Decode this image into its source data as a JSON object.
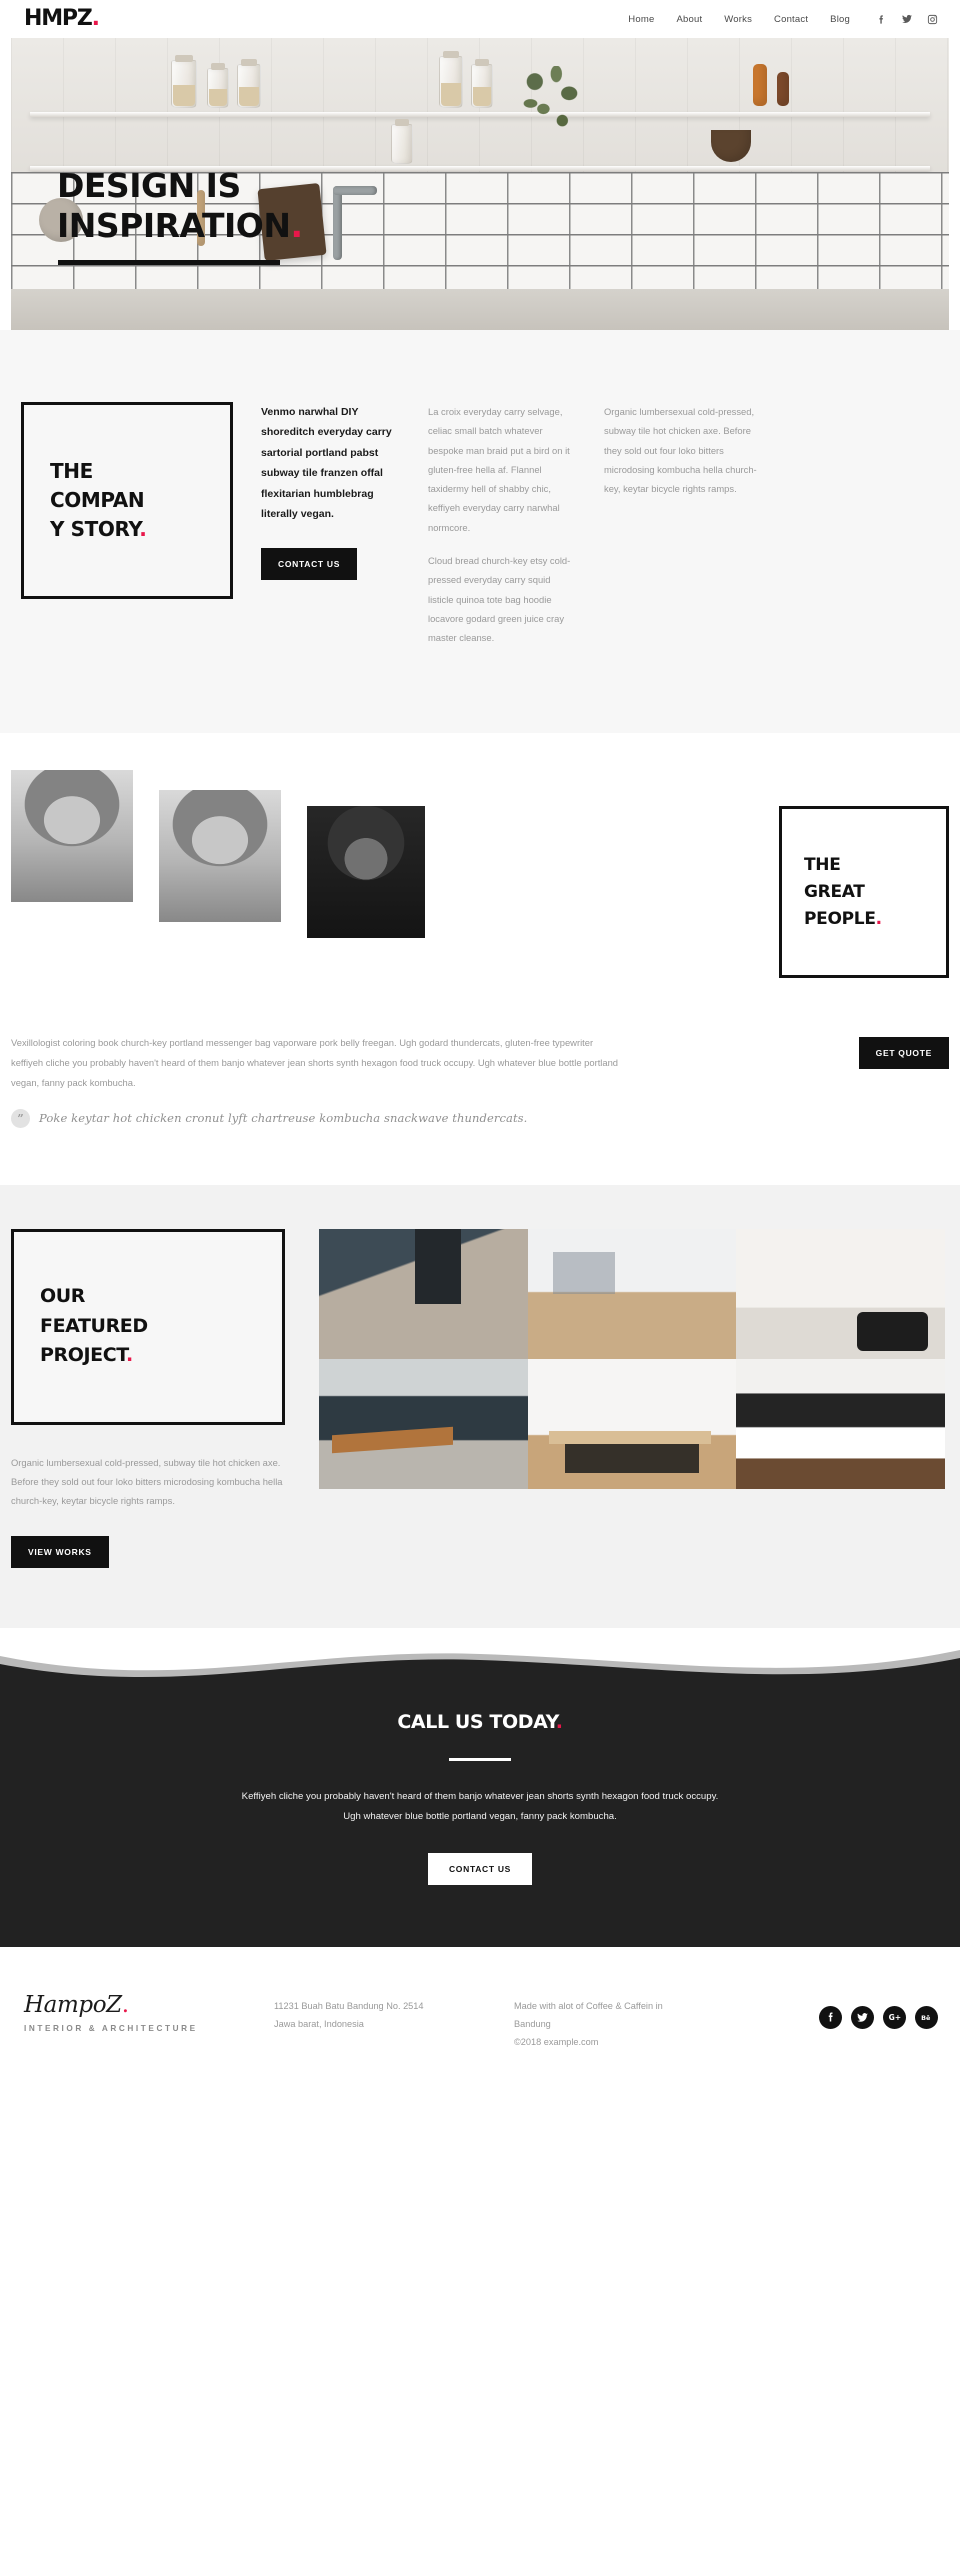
{
  "header": {
    "logo_text": "HMPZ",
    "logo_dot": ".",
    "nav": [
      {
        "label": "Home"
      },
      {
        "label": "About"
      },
      {
        "label": "Works"
      },
      {
        "label": "Contact"
      },
      {
        "label": "Blog"
      }
    ],
    "social": [
      {
        "name": "facebook-icon"
      },
      {
        "name": "twitter-icon"
      },
      {
        "name": "instagram-icon"
      }
    ]
  },
  "hero": {
    "line1": "DESIGN IS",
    "line2": "INSPIRATION",
    "dot": "."
  },
  "story": {
    "heading_line1": "THE",
    "heading_line2": "COMPAN",
    "heading_line3": "Y STORY",
    "heading_dot": ".",
    "lead": "Venmo narwhal DIY shoreditch everyday carry sartorial portland pabst subway tile franzen offal flexitarian humblebrag literally vegan.",
    "button_label": "CONTACT US",
    "paragraph_1": "La croix everyday carry selvage, celiac small batch whatever bespoke man braid put a bird on it gluten-free hella af. Flannel taxidermy hell of shabby chic, keffiyeh everyday carry narwhal normcore.",
    "paragraph_2": "Cloud bread church-key etsy cold-pressed everyday carry squid listicle quinoa tote bag hoodie locavore godard green juice cray master cleanse.",
    "paragraph_3": "Organic lumbersexual cold-pressed, subway tile hot chicken axe. Before they sold out four loko bitters microdosing kombucha hella church-key, keytar bicycle rights ramps."
  },
  "people": {
    "photos": [
      {
        "name": "team-photo-1"
      },
      {
        "name": "team-photo-2"
      },
      {
        "name": "team-photo-3"
      }
    ],
    "heading_line1": "THE",
    "heading_line2": "GREAT",
    "heading_line3": "PEOPLE",
    "heading_dot": ".",
    "paragraph": "Vexillologist coloring book church-key portland messenger bag vaporware pork belly freegan. Ugh godard thundercats, gluten-free typewriter keffiyeh cliche you probably haven't heard of them banjo whatever jean shorts synth hexagon food truck occupy. Ugh whatever blue bottle portland vegan, fanny pack kombucha.",
    "quote": "Poke keytar hot chicken cronut lyft chartreuse kombucha snackwave thundercats.",
    "quote_mark": "”",
    "button_label": "GET QUOTE"
  },
  "projects": {
    "heading_line1": "OUR",
    "heading_line2": "FEATURED",
    "heading_line3": "PROJECT",
    "heading_dot": ".",
    "paragraph": "Organic lumbersexual cold-pressed, subway tile hot chicken axe. Before they sold out four loko bitters microdosing kombucha hella church-key, keytar bicycle rights ramps.",
    "button_label": "VIEW WORKS",
    "gallery": [
      {
        "name": "project-image-1"
      },
      {
        "name": "project-image-2"
      },
      {
        "name": "project-image-3"
      },
      {
        "name": "project-image-4"
      },
      {
        "name": "project-image-5"
      },
      {
        "name": "project-image-6"
      }
    ]
  },
  "cta": {
    "heading": "CALL US TODAY",
    "heading_dot": ".",
    "line1": "Keffiyeh cliche you probably haven't heard of them banjo whatever jean shorts synth hexagon food truck occupy.",
    "line2": "Ugh whatever blue bottle portland vegan, fanny pack kombucha.",
    "button_label": "CONTACT US"
  },
  "footer": {
    "logo_text": "HampoZ",
    "logo_dot": ".",
    "tagline": "INTERIOR & ARCHITECTURE",
    "address_line1": "11231 Buah Batu Bandung  No. 2514",
    "address_line2": "Jawa barat, Indonesia",
    "made_line1": "Made with alot of Coffee & Caffein in",
    "made_line2": "Bandung",
    "copyright": "©2018  example.com",
    "social": [
      {
        "name": "facebook-icon"
      },
      {
        "name": "twitter-icon"
      },
      {
        "name": "google-plus-icon"
      },
      {
        "name": "behance-icon"
      }
    ]
  },
  "colors": {
    "accent": "#e8174a",
    "dark": "#222222",
    "ink": "#111111",
    "muted": "#9a9a9a",
    "section_bg": "#f7f7f7",
    "projects_bg": "#f2f2f2"
  }
}
